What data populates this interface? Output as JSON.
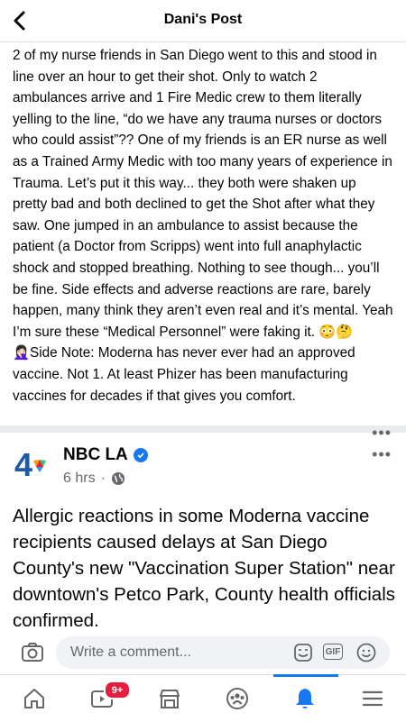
{
  "header": {
    "title": "Dani's Post",
    "back_icon": "chevron-left-icon"
  },
  "post": {
    "text": "2 of my nurse friends in San Diego went to this and stood in line over an hour to get their shot.  Only to watch 2 ambulances arrive and 1 Fire Medic crew to them literally yelling to the line, “do we have any trauma nurses or doctors who could assist”?? One of my friends is an ER nurse as well as a Trained Army Medic with too many years of experience in Trauma.  Let’s put it this way... they both were shaken up pretty bad and both declined to get the Shot after what they saw.  One jumped in an ambulance to assist because the patient (a Doctor from Scripps) went into full anaphylactic shock and stopped breathing.  Nothing to see though... you’ll be fine.  Side effects and adverse reactions are rare, barely happen, many think they aren’t even real and it’s mental. Yeah I’m sure these “Medical Personnel” were faking it.  😳🤔🤦🏻‍♀️Side Note: Moderna has never ever had an approved vaccine. Not 1.  At least Phizer has been manufacturing vaccines for decades if that gives you comfort."
  },
  "shared_post": {
    "page_name": "NBC LA",
    "time": "6 hrs",
    "separator": "·",
    "more": "•••",
    "text": "Allergic reactions in some Moderna vaccine recipients caused delays at San Diego County's new \"Vaccination Super Station\" near downtown's Petco Park, County health officials confirmed."
  },
  "comment_bar": {
    "placeholder": "Write a comment...",
    "gif_label": "GIF"
  },
  "nav": {
    "items": [
      "home-icon",
      "watch-icon",
      "marketplace-icon",
      "groups-icon",
      "notifications-icon",
      "menu-icon"
    ],
    "watch_badge": "9+",
    "active": "notifications-icon"
  },
  "colors": {
    "accent": "#1877f2",
    "badge": "#e41e3f",
    "nbc_red": "#e41e3f"
  }
}
